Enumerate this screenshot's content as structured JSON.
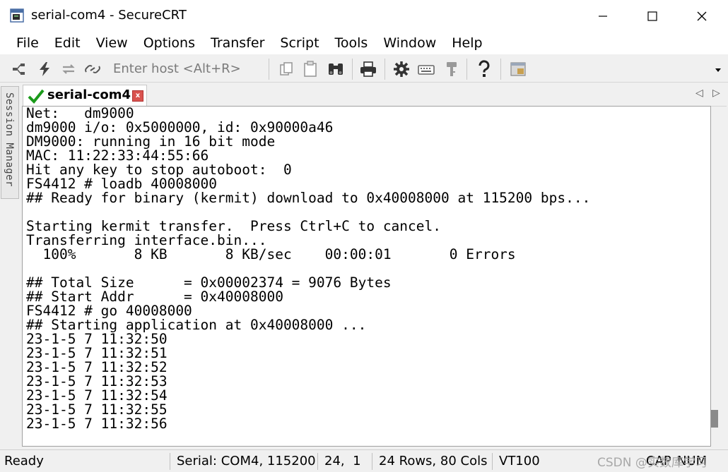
{
  "window": {
    "title": "serial-com4 - SecureCRT"
  },
  "menu": [
    "File",
    "Edit",
    "View",
    "Options",
    "Transfer",
    "Script",
    "Tools",
    "Window",
    "Help"
  ],
  "toolbar": {
    "host_placeholder": "Enter host <Alt+R>",
    "icons": [
      "connect-bar-icon",
      "quick-connect-icon",
      "reconnect-icon",
      "disconnect-icon",
      "copy-icon",
      "paste-icon",
      "find-icon",
      "print-icon",
      "settings-icon",
      "keymap-icon",
      "key-icon",
      "help-icon",
      "sftp-icon"
    ]
  },
  "side_panel": {
    "label": "Session Manager"
  },
  "tab": {
    "label": "serial-com4",
    "close": "x"
  },
  "terminal": {
    "lines": [
      "Net:   dm9000",
      "dm9000 i/o: 0x5000000, id: 0x90000a46",
      "DM9000: running in 16 bit mode",
      "MAC: 11:22:33:44:55:66",
      "Hit any key to stop autoboot:  0",
      "FS4412 # loadb 40008000",
      "## Ready for binary (kermit) download to 0x40008000 at 115200 bps...",
      "",
      "Starting kermit transfer.  Press Ctrl+C to cancel.",
      "Transferring interface.bin...",
      "  100%       8 KB       8 KB/sec    00:00:01       0 Errors",
      "",
      "## Total Size      = 0x00002374 = 9076 Bytes",
      "## Start Addr      = 0x40008000",
      "FS4412 # go 40008000",
      "## Starting application at 0x40008000 ...",
      "23-1-5 7 11:32:50",
      "23-1-5 7 11:32:51",
      "23-1-5 7 11:32:52",
      "23-1-5 7 11:32:53",
      "23-1-5 7 11:32:54",
      "23-1-5 7 11:32:55",
      "23-1-5 7 11:32:56"
    ]
  },
  "status": {
    "ready": "Ready",
    "serial": "Serial: COM4, 115200",
    "cursor": "24,  1",
    "size": "24 Rows, 80 Cols",
    "emulation": "VT100",
    "caps": "CAP",
    "num": "NUM",
    "watermark": "CSDN @实数库学习"
  }
}
